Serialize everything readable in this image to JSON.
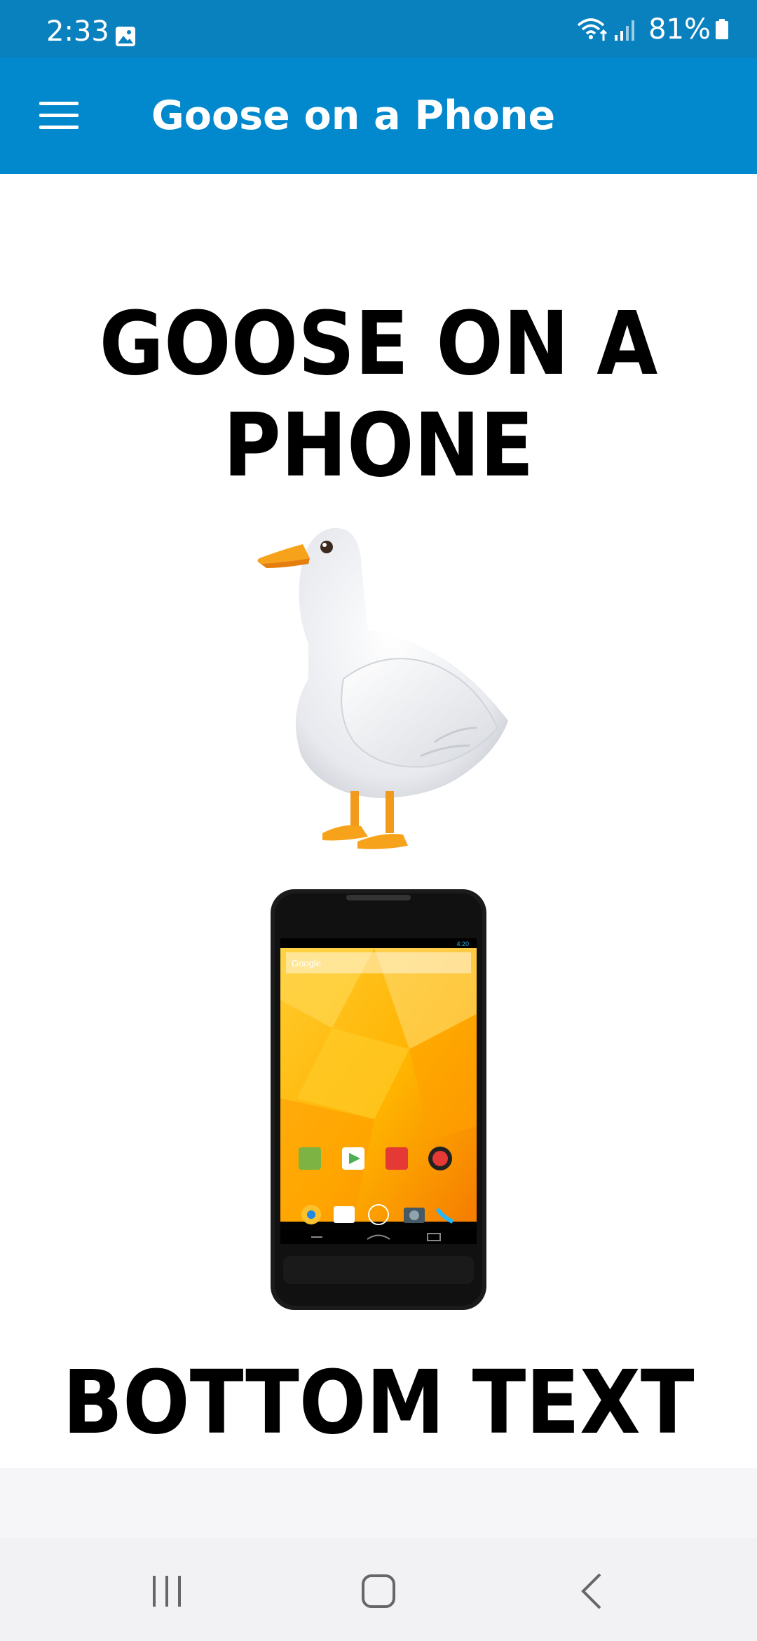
{
  "status_bar": {
    "time": "2:33",
    "battery": "81%",
    "icons": [
      "gallery-notification-icon",
      "wifi-icon",
      "signal-icon",
      "battery-icon"
    ]
  },
  "app_bar": {
    "title": "Goose on a Phone",
    "menu_icon": "hamburger-menu-icon",
    "color": "#0288cc"
  },
  "meme": {
    "top_text": "GOOSE ON A PHONE",
    "bottom_text": "BOTTOM TEXT"
  },
  "phone_screen_apps": {
    "search_label": "Google",
    "row1": [
      "Maps",
      "Play Store",
      "YouTube",
      "Google+"
    ],
    "time": "4:20"
  },
  "nav_bar": {
    "icons": [
      "recents-icon",
      "home-icon",
      "back-icon"
    ]
  }
}
